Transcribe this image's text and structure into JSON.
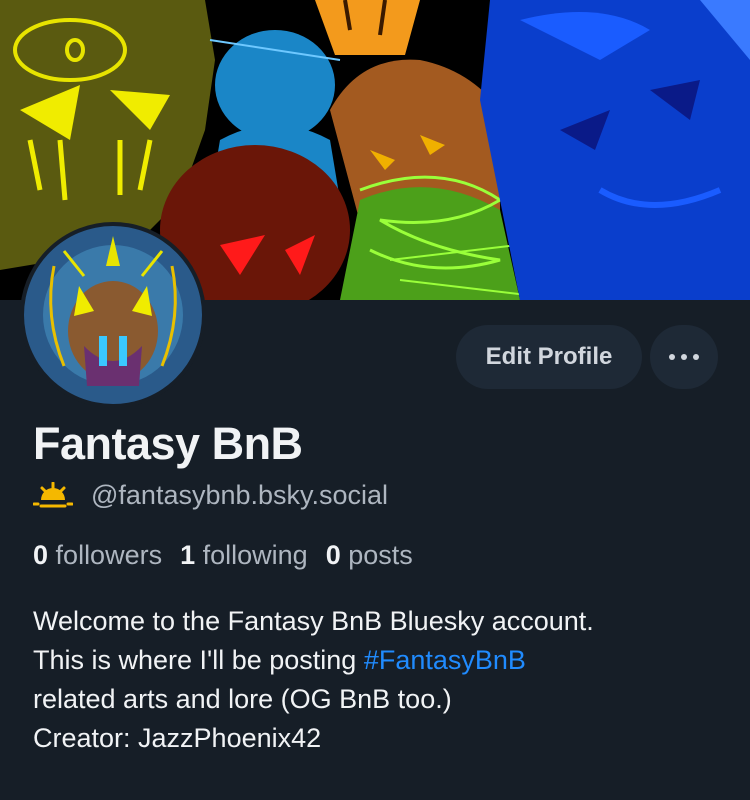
{
  "profile": {
    "display_name": "Fantasy BnB",
    "handle": "@fantasybnb.bsky.social",
    "edit_profile_label": "Edit Profile",
    "more_icon": "ellipsis-icon",
    "handle_badge_icon": "sunrise-icon"
  },
  "stats": {
    "followers_count": "0",
    "followers_label": "followers",
    "following_count": "1",
    "following_label": "following",
    "posts_count": "0",
    "posts_label": "posts"
  },
  "bio": {
    "line1": "Welcome to the Fantasy BnB Bluesky account.",
    "line2_prefix": "This is where I'll be posting ",
    "hashtag": "#FantasyBnB",
    "line3": "related arts and lore (OG BnB too.)",
    "line4": "Creator: JazzPhoenix42"
  },
  "colors": {
    "background": "#161e27",
    "button_bg": "#1e2936",
    "text_primary": "#f1f3f5",
    "text_secondary": "#aeb6c0",
    "link": "#208bfe",
    "badge": "#f5b800"
  }
}
